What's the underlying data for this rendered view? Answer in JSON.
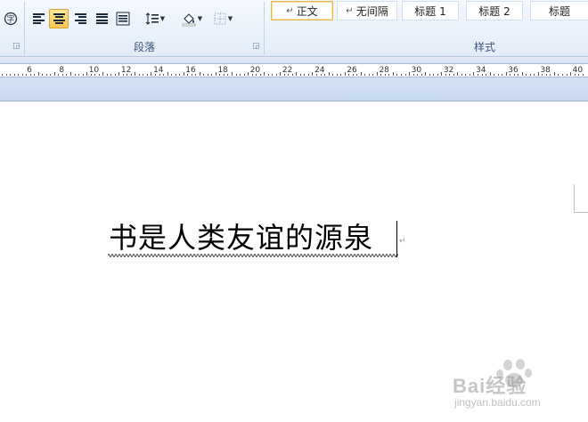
{
  "ribbon": {
    "paragraph_group": {
      "label": "段落",
      "launcher_icon": "dialog-launcher-icon"
    },
    "styles_group": {
      "label": "样式",
      "styles": [
        {
          "name": "正文",
          "selected": true,
          "mark": "↵"
        },
        {
          "name": "无间隔",
          "selected": false,
          "mark": "↵"
        },
        {
          "name": "标题 1",
          "selected": false,
          "mark": ""
        },
        {
          "name": "标题 2",
          "selected": false,
          "mark": ""
        },
        {
          "name": "标题",
          "selected": false,
          "mark": ""
        }
      ]
    },
    "font_group_launcher_icon": "dialog-launcher-icon",
    "accent_active": "#f8c74e"
  },
  "ruler": {
    "labels": [
      "6",
      "8",
      "10",
      "12",
      "14",
      "16",
      "18",
      "20",
      "22",
      "24",
      "26",
      "28",
      "30",
      "32",
      "34",
      "36",
      "38",
      "40"
    ]
  },
  "document": {
    "text": "书是人类友谊的源泉"
  },
  "watermark": {
    "brand": "Bai经验",
    "url": "jingyan.baidu.com"
  }
}
